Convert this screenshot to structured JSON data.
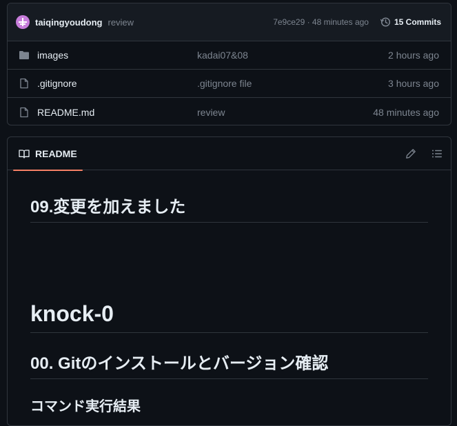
{
  "commit_bar": {
    "user": "taiqingyoudong",
    "message": "review",
    "meta": "7e9ce29 · 48 minutes ago",
    "commits_label": "15 Commits"
  },
  "files": [
    {
      "icon": "folder-icon",
      "name": "images",
      "commit": "kadai07&08",
      "age": "2 hours ago"
    },
    {
      "icon": "file-icon",
      "name": ".gitignore",
      "commit": ".gitignore file",
      "age": "3 hours ago"
    },
    {
      "icon": "file-icon",
      "name": "README.md",
      "commit": "review",
      "age": "48 minutes ago"
    }
  ],
  "readme": {
    "tab_label": "README",
    "heading_1": "09.変更を加えました",
    "heading_2": "knock-0",
    "heading_3": "00. Gitのインストールとバージョン確認",
    "heading_4": "コマンド実行結果"
  },
  "colors": {
    "background": "#0d1117",
    "border": "#30363d",
    "muted": "#7d8590",
    "accent_underline": "#f78166",
    "avatar": "#c77ddb"
  }
}
